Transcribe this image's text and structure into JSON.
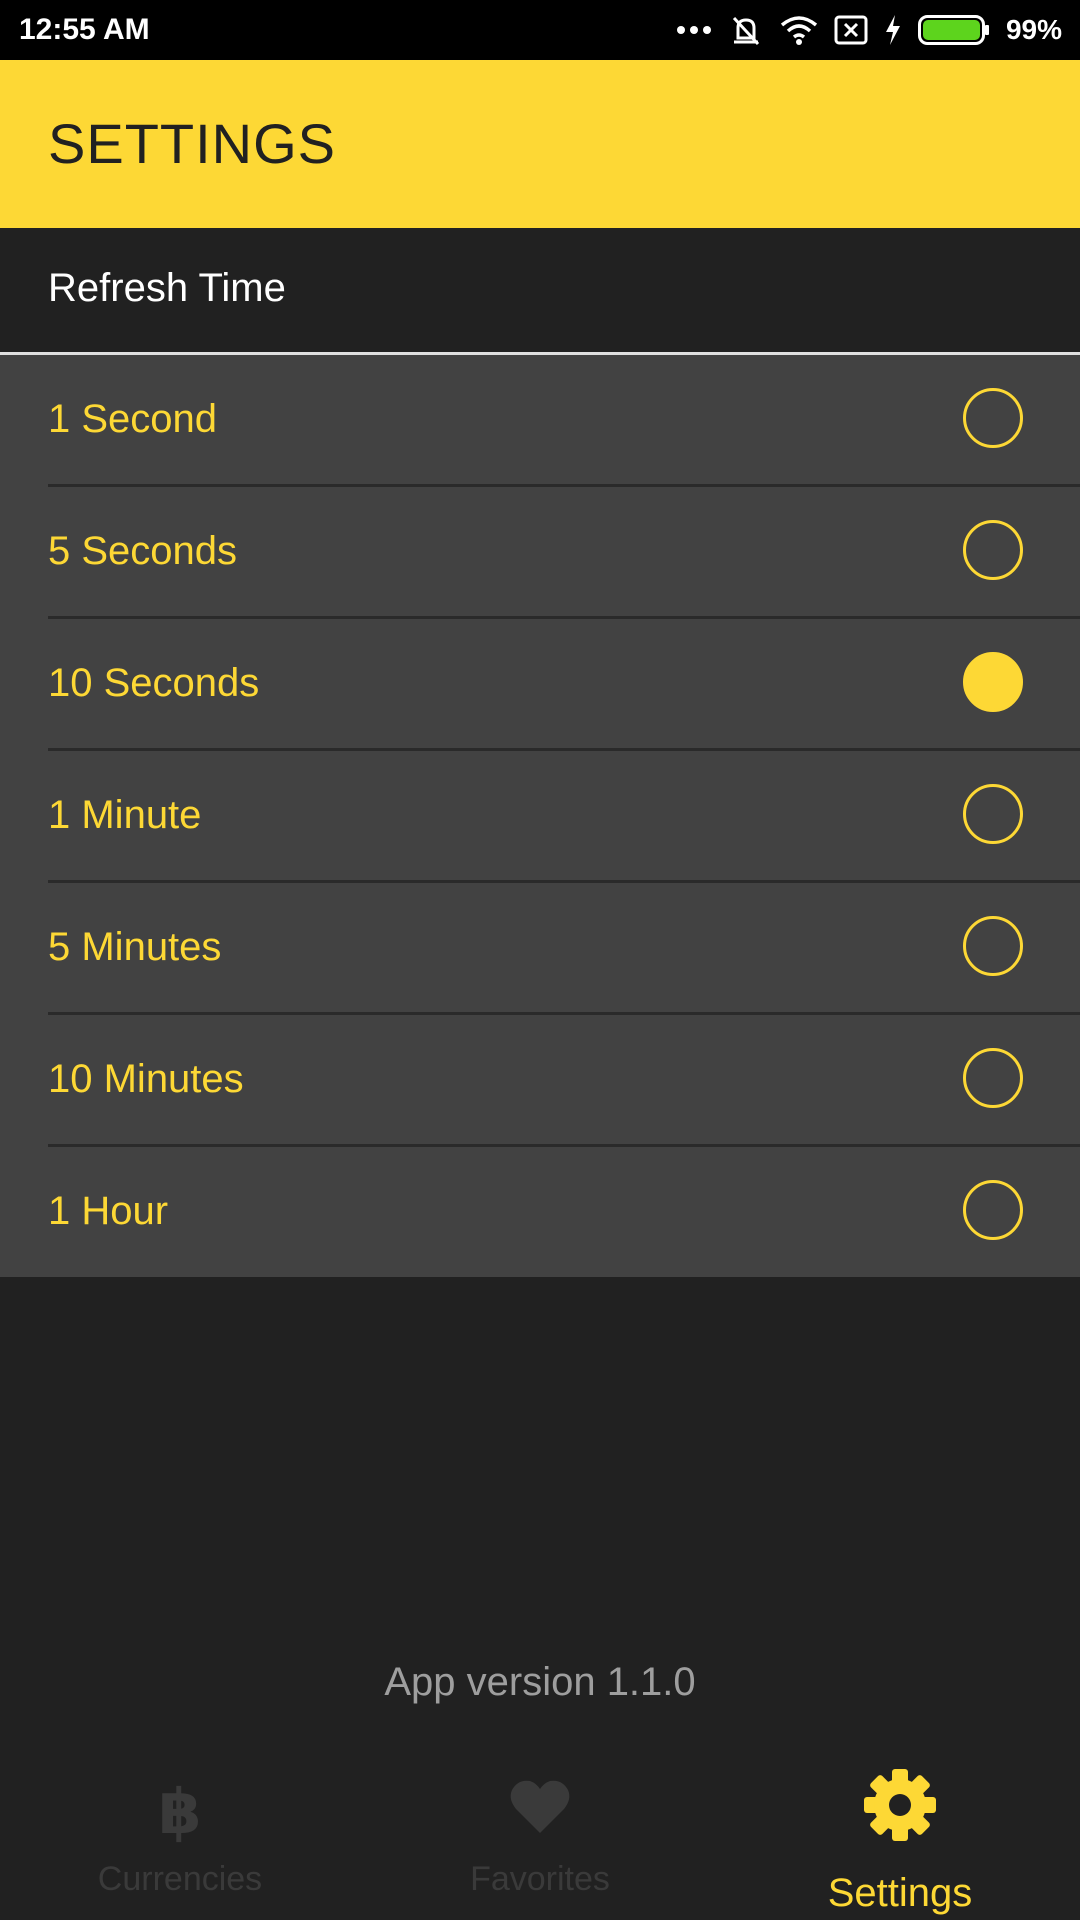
{
  "status_bar": {
    "time": "12:55 AM",
    "battery": "99%",
    "icons": [
      "more-dots-icon",
      "vibrate-off-icon",
      "wifi-icon",
      "sim-x-icon",
      "charging-bolt-icon",
      "battery-icon"
    ]
  },
  "app_bar": {
    "title": "SETTINGS"
  },
  "section": {
    "title": "Refresh Time"
  },
  "options": [
    {
      "label": "1 Second",
      "selected": false
    },
    {
      "label": "5 Seconds",
      "selected": false
    },
    {
      "label": "10 Seconds",
      "selected": true
    },
    {
      "label": "1 Minute",
      "selected": false
    },
    {
      "label": "5 Minutes",
      "selected": false
    },
    {
      "label": "10 Minutes",
      "selected": false
    },
    {
      "label": "1 Hour",
      "selected": false
    }
  ],
  "version": "App version 1.1.0",
  "nav": [
    {
      "label": "Currencies",
      "icon": "bitcoin-icon",
      "active": false
    },
    {
      "label": "Favorites",
      "icon": "heart-icon",
      "active": false
    },
    {
      "label": "Settings",
      "icon": "gear-icon",
      "active": true
    }
  ],
  "colors": {
    "accent": "#fdd835",
    "background": "#212121",
    "list_bg": "#424242"
  }
}
